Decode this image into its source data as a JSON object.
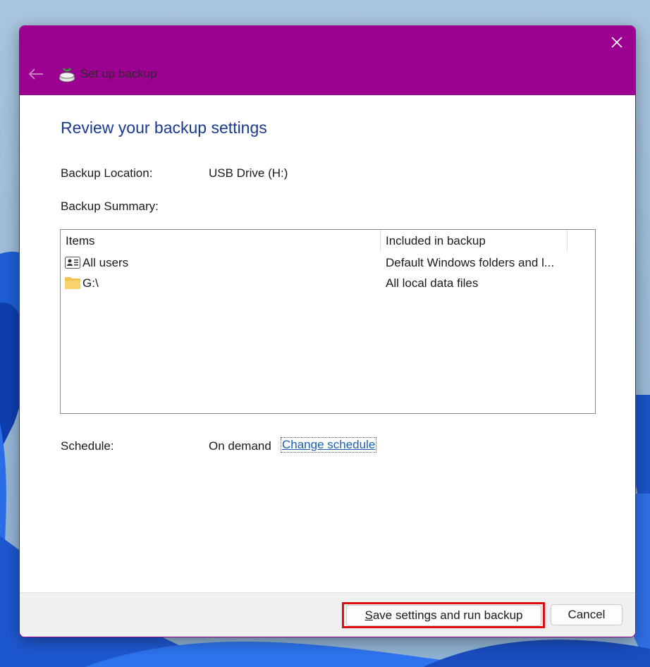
{
  "window": {
    "title": "Set up backup",
    "close_glyph": "✕",
    "back_glyph": "←",
    "titlebar_color": "#9c0091"
  },
  "page": {
    "heading": "Review your backup settings",
    "backup_location_label": "Backup Location:",
    "backup_location_value": "USB Drive (H:)",
    "backup_summary_label": "Backup Summary:",
    "schedule_label": "Schedule:",
    "schedule_value": "On demand",
    "change_schedule_link": "Change schedule"
  },
  "summary_table": {
    "columns": [
      "Items",
      "Included in backup"
    ],
    "rows": [
      {
        "item": "All users",
        "included": "Default Windows folders and l...",
        "icon": "users-icon"
      },
      {
        "item": "G:\\",
        "included": "All local data files",
        "icon": "folder-icon"
      }
    ]
  },
  "buttons": {
    "save_run_accel": "S",
    "save_run_rest": "ave settings and run backup",
    "cancel": "Cancel"
  },
  "colors": {
    "heading": "#1b3a8f",
    "link": "#1a5fb4",
    "highlight": "#e01010"
  }
}
